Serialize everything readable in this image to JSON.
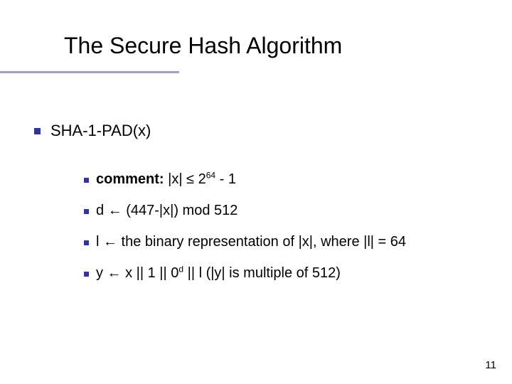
{
  "title": "The Secure Hash Algorithm",
  "level1": {
    "text": "SHA-1-PAD(x)"
  },
  "items": [
    {
      "bold_prefix": "comment:",
      "rest": " |x| ≤ 2",
      "sup": "64",
      "tail": " - 1"
    },
    {
      "text": "d ← (447-|x|) mod 512"
    },
    {
      "text": "l ← the binary representation of |x|, where |l| = 64"
    },
    {
      "pre": "y ← x || 1 || 0",
      "sup": "d",
      "mid": " || l   (|y| is multiple of 512)"
    }
  ],
  "page_number": "11"
}
